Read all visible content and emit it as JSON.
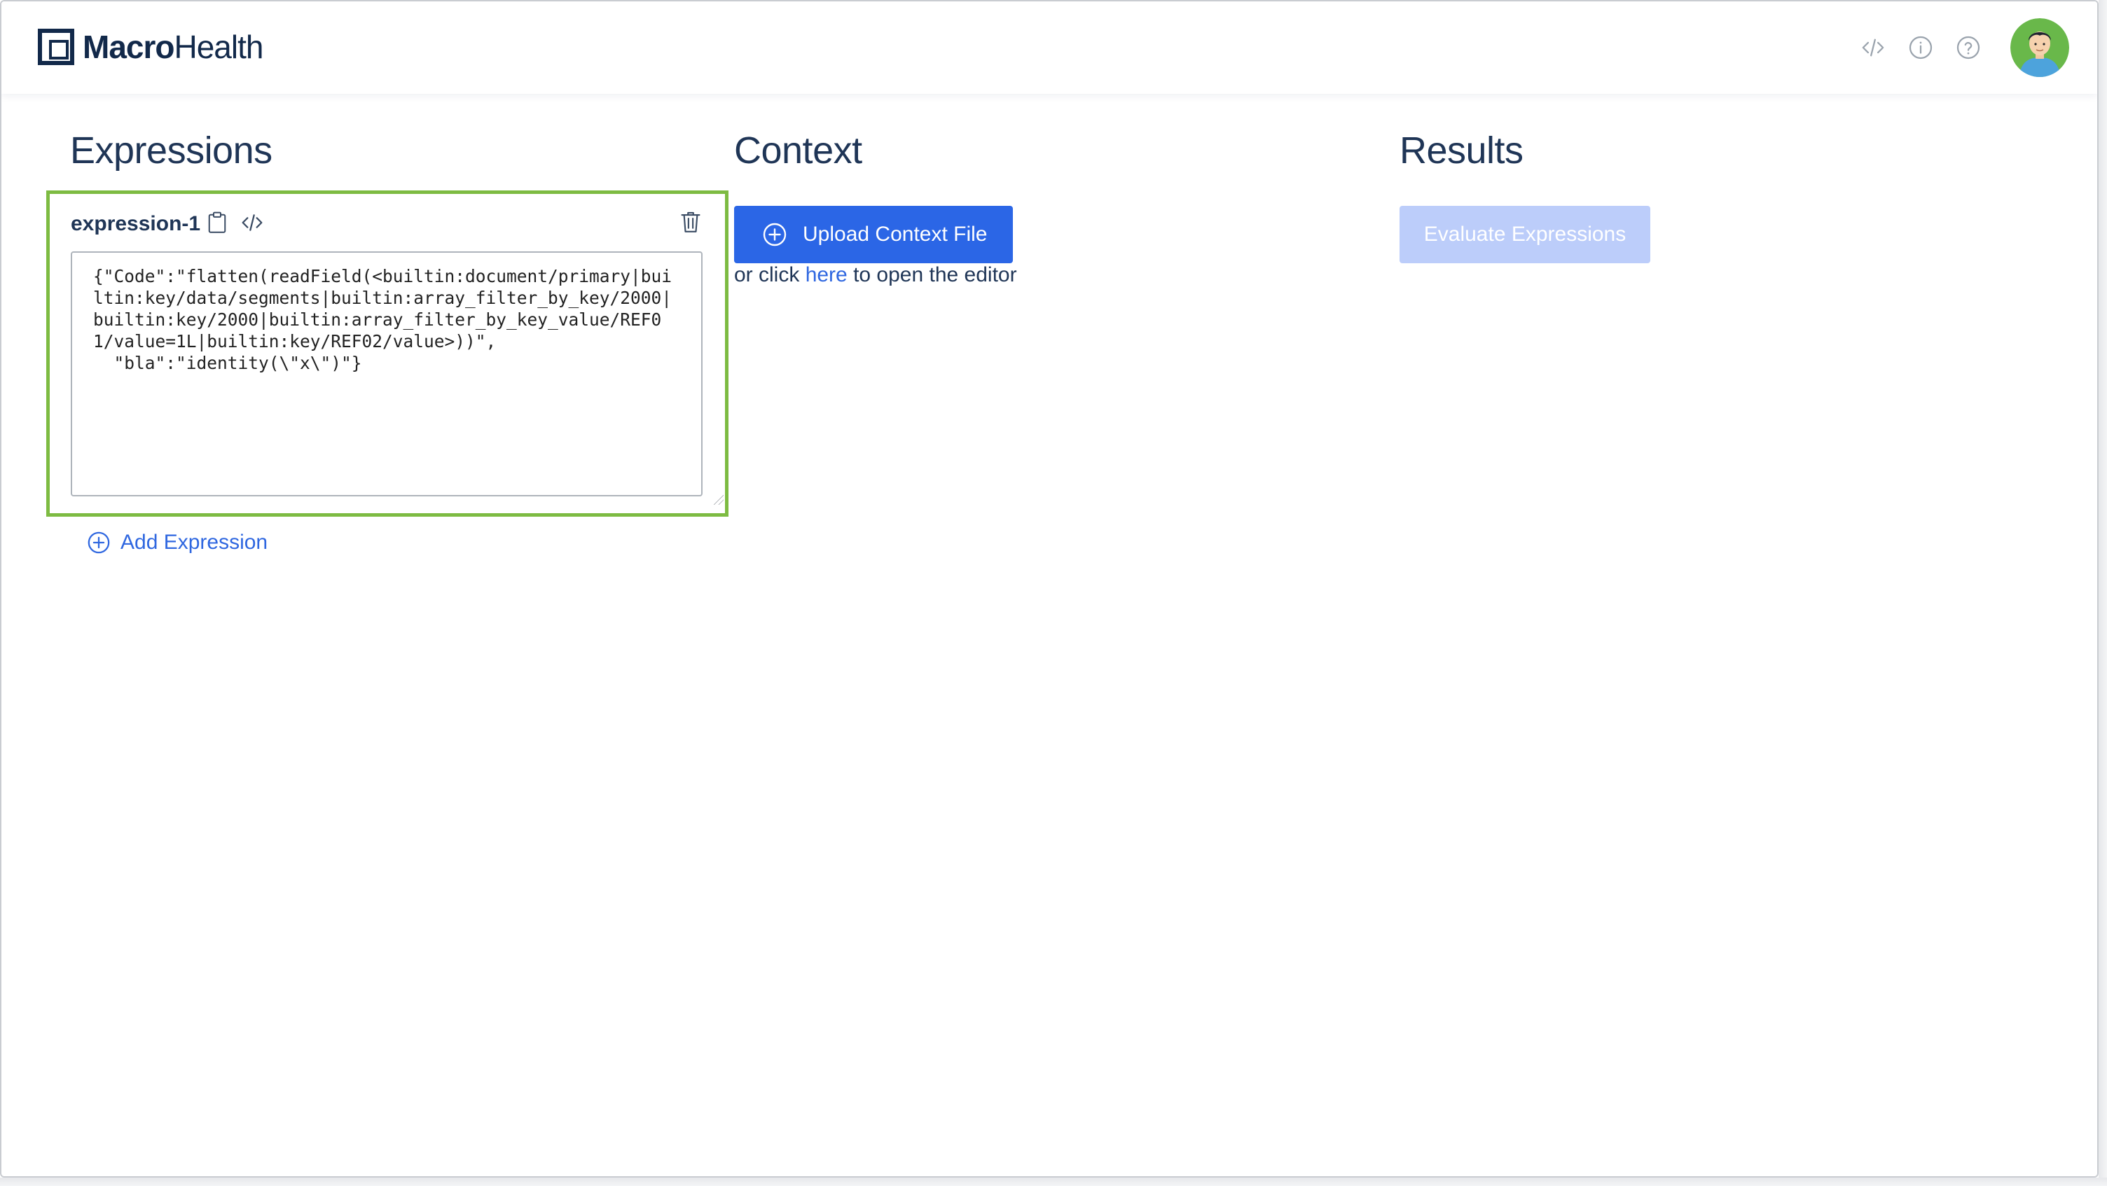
{
  "header": {
    "logo_bold": "Macro",
    "logo_regular": "Health",
    "icons": [
      "code-icon",
      "info-icon",
      "help-icon"
    ],
    "avatar": "user-avatar"
  },
  "expressions": {
    "title": "Expressions",
    "items": [
      {
        "name": "expression-1",
        "code": "{\"Code\":\"flatten(readField(<builtin:document/primary|builtin:key/data/segments|builtin:array_filter_by_key/2000|builtin:key/2000|builtin:array_filter_by_key_value/REF01/value=1L|builtin:key/REF02/value>))\",\n  \"bla\":\"identity(\\\"x\\\")\"}"
      }
    ],
    "add_label": "Add Expression"
  },
  "context": {
    "title": "Context",
    "upload_label": "Upload Context File",
    "hint_prefix": "or click",
    "hint_link": "here",
    "hint_suffix": "to open the editor"
  },
  "results": {
    "title": "Results",
    "evaluate_label": "Evaluate Expressions"
  },
  "colors": {
    "accent": "#2b66e6",
    "card_border": "#7dbb42",
    "disabled_button": "#bccdfa",
    "text": "#1f3556"
  }
}
